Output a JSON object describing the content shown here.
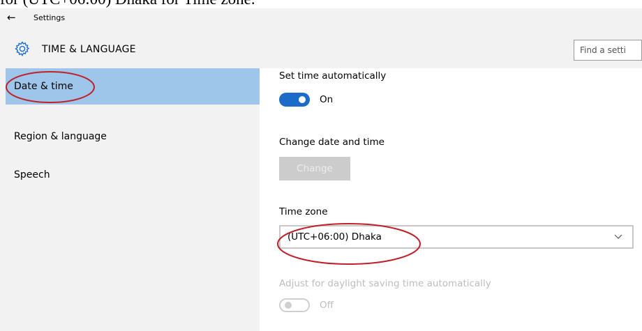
{
  "caption": "for (UTC+06:00) Dhaka for Time zone.",
  "window": {
    "title": "Settings"
  },
  "header": {
    "section_title": "TIME & LANGUAGE",
    "search_placeholder": "Find a setti"
  },
  "sidebar": {
    "items": [
      {
        "label": "Date & time",
        "active": true
      },
      {
        "label": "Region & language"
      },
      {
        "label": "Speech"
      }
    ]
  },
  "content": {
    "set_time_auto": {
      "label": "Set time automatically",
      "state": "On"
    },
    "change_date_time": {
      "label": "Change date and time",
      "button": "Change"
    },
    "time_zone": {
      "label": "Time zone",
      "value": "(UTC+06:00) Dhaka"
    },
    "daylight_saving": {
      "label": "Adjust for daylight saving time automatically",
      "state": "Off"
    }
  },
  "colors": {
    "accent": "#1a6cc8",
    "selected_nav": "#9ec6ea",
    "annotation": "#c0202a"
  },
  "icons": {
    "back": "arrow-left-icon",
    "section": "gear-icon",
    "dropdown": "chevron-down-icon"
  }
}
